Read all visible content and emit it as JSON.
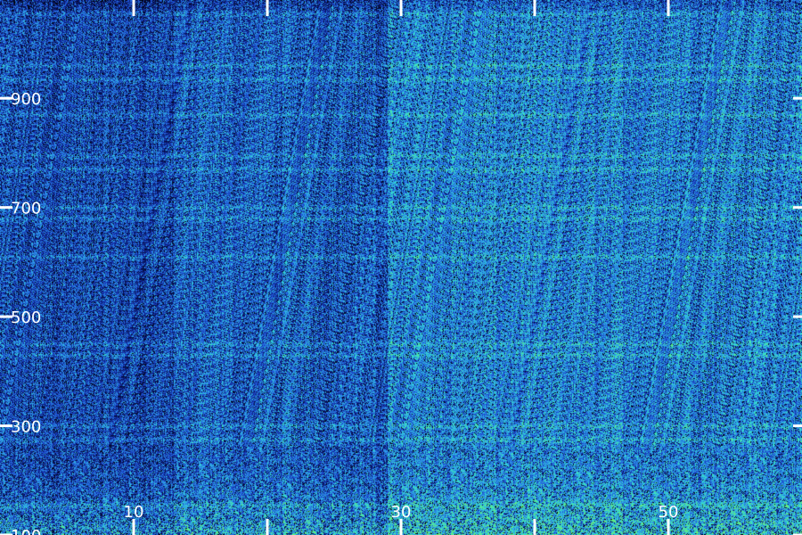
{
  "chart_data": {
    "type": "heatmap",
    "title": "",
    "xlabel": "",
    "ylabel": "",
    "x_ticks": [
      10,
      30,
      50
    ],
    "y_ticks": [
      100,
      300,
      500,
      700,
      900
    ],
    "x_minor_ticks": [
      0,
      10,
      20,
      30,
      40,
      50
    ],
    "xlim": [
      0,
      60
    ],
    "ylim": [
      100,
      1080
    ],
    "grid": false,
    "colormap": [
      "#000000",
      "#0a1a7a",
      "#1f4fd6",
      "#2fa0e8",
      "#33e0d0",
      "#6df26a"
    ],
    "description_bands": {
      "horizontal_band_y": [
        1055,
        960,
        935,
        870,
        795,
        770,
        700,
        680,
        610,
        450,
        430,
        300,
        275,
        155
      ],
      "high_energy_x_start": 40,
      "higher_intensity_segments": [
        {
          "x_from": 13,
          "x_to": 28,
          "level": 0.55
        },
        {
          "x_from": 29,
          "x_to": 60,
          "level": 0.65
        }
      ],
      "low_frequency_burst_level": 0.9
    }
  }
}
